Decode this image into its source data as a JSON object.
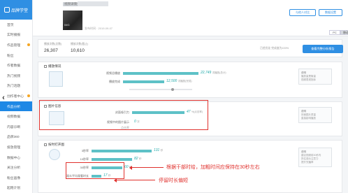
{
  "sidebar": {
    "brand": "品牌学堂",
    "items": [
      {
        "label": "首页",
        "active": false,
        "dot": false
      },
      {
        "label": "实时播报",
        "active": false,
        "dot": false
      },
      {
        "label": "作品管理",
        "active": false,
        "dot": true
      },
      {
        "label": "粉丝",
        "active": false,
        "dot": false
      },
      {
        "label": "作者数据",
        "active": false,
        "dot": false
      },
      {
        "label": "热门视频",
        "active": false,
        "dot": false
      },
      {
        "label": "热门话题",
        "active": false,
        "dot": false
      },
      {
        "label": "创作者中心",
        "active": false,
        "dot": true
      },
      {
        "label": "作品分析",
        "active": true,
        "dot": false
      },
      {
        "label": "视频数据",
        "active": false,
        "dot": false
      },
      {
        "label": "内容诊断",
        "active": false,
        "dot": false
      },
      {
        "label": "品牌360",
        "active": false,
        "dot": false
      },
      {
        "label": "投放管理",
        "active": false,
        "dot": false
      },
      {
        "label": "数据中心",
        "active": false,
        "dot": false
      },
      {
        "label": "关注分析",
        "active": false,
        "dot": false
      },
      {
        "label": "粉丝画像",
        "active": false,
        "dot": false
      },
      {
        "label": "起跑计划",
        "active": false,
        "dot": false
      }
    ]
  },
  "header": {
    "video_title": "视频详情分析",
    "thumb_caption": "IMG",
    "meta": "发布时间 · 2019-09-07",
    "btn_compare": "与他人对比",
    "btn_settings": "数据设置",
    "toggle": [
      "PC",
      "移动"
    ]
  },
  "stats": {
    "items": [
      {
        "label": "播放次数(总数)",
        "value": "26,307"
      },
      {
        "label": "播放次数(截止)",
        "value": "10,610"
      }
    ],
    "note": "已经优化 完成度为100%",
    "primary_button": "查看完整分析报告"
  },
  "sections": {
    "s1": {
      "title": "播放情况",
      "rows": [
        {
          "label": "视频总播放",
          "value": "22,749",
          "unit": "次播放(总计)",
          "fraction": 1.0
        },
        {
          "label": "播放完成",
          "value": "12,500",
          "unit": "次播放(完成)",
          "fraction": 0.55
        }
      ],
      "tip_title": "说明",
      "tip_lines": [
        "播放量是衡量",
        "视频表现指标"
      ]
    },
    "s2": {
      "title": "图片信息",
      "rows": [
        {
          "label": "封面吸引力",
          "value": "47",
          "unit": "%(点击率)",
          "fraction": 0.78
        },
        {
          "label": "视频中的图片展示",
          "value": "0",
          "unit": "次",
          "fraction": 0.0
        }
      ],
      "row2_sub": "点击率",
      "tip_title": "说明",
      "tip_lines": [
        "封面图片质量",
        "直接影响播放"
      ]
    },
    "s3": {
      "title": "按时打开图",
      "rows": [
        {
          "label": "3秒率",
          "value": "131",
          "unit": "秒",
          "fraction": 0.9
        },
        {
          "label": "10秒率",
          "value": "82",
          "unit": "秒",
          "fraction": 0.6
        },
        {
          "label": "30秒率",
          "value": "60",
          "unit": "秒",
          "fraction": 0.46
        },
        {
          "label": "观众平均观看时长",
          "value": "17",
          "unit": "秒",
          "fraction": 0.15
        }
      ],
      "tip_title": "说明",
      "tip_lines": [
        "建议视频前30秒内",
        "抓住观众注意力",
        "提升完播率"
      ]
    }
  },
  "annotations": {
    "a1": "根据干部时给，加粗时间应保持在30秒左右",
    "a2": "停留时长偏短"
  },
  "colors": {
    "accent": "#2f8fe3",
    "bar": "#5ec1c7",
    "annotation": "#e0312d"
  }
}
